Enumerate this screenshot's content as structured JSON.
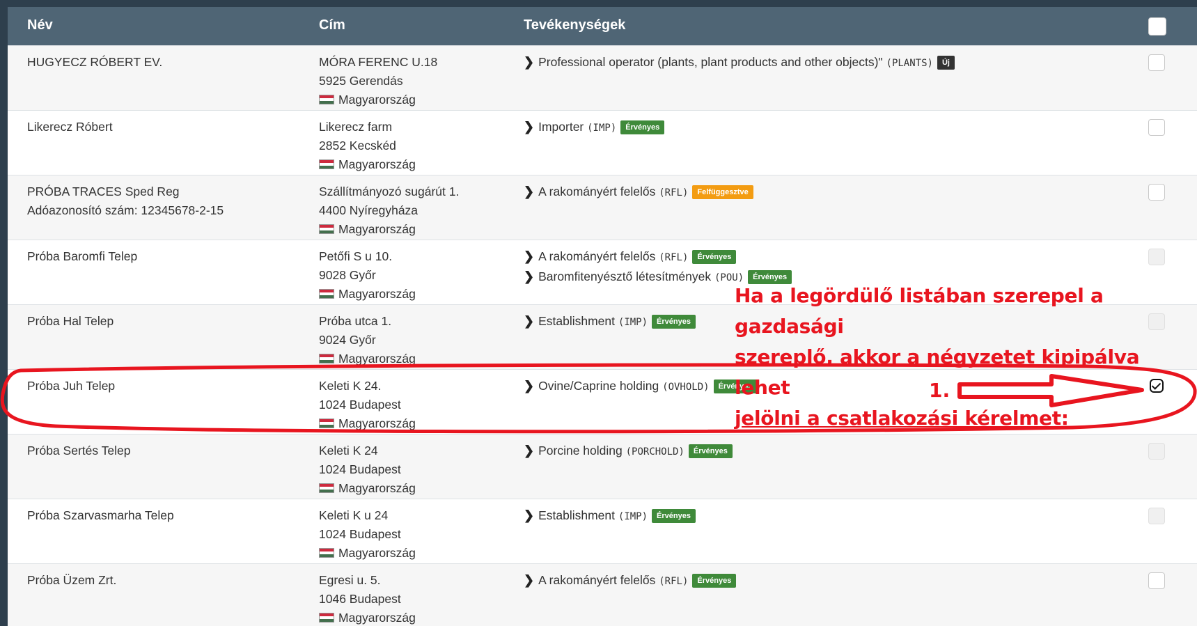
{
  "table": {
    "headers": {
      "name": "Név",
      "address": "Cím",
      "activities": "Tevékenységek"
    },
    "rows": [
      {
        "name": [
          "HUGYECZ RÓBERT EV."
        ],
        "address": [
          "MÓRA FERENC U.18",
          "5925 Gerendás",
          "Magyarország"
        ],
        "activities": [
          {
            "text": "Professional operator (plants, plant products and other objects)\"",
            "code": "(PLANTS)",
            "badge": "Új",
            "status": "dark"
          }
        ],
        "checkbox": "enabled"
      },
      {
        "name": [
          "Likerecz Róbert"
        ],
        "address": [
          "Likerecz farm",
          "2852 Kecskéd",
          "Magyarország"
        ],
        "activities": [
          {
            "text": "Importer",
            "code": "(IMP)",
            "badge": "Érvényes",
            "status": "green"
          }
        ],
        "checkbox": "enabled"
      },
      {
        "name": [
          "PRÓBA TRACES Sped Reg",
          "Adóazonosító szám: 12345678-2-15"
        ],
        "address": [
          "Szállítmányozó sugárút 1.",
          "4400 Nyíregyháza",
          "Magyarország"
        ],
        "activities": [
          {
            "text": "A rakományért felelős",
            "code": "(RFL)",
            "badge": "Felfüggesztve",
            "status": "orange"
          }
        ],
        "checkbox": "enabled"
      },
      {
        "name": [
          "Próba Baromfi Telep"
        ],
        "address": [
          "Petőfi S u 10.",
          "9028 Győr",
          "Magyarország"
        ],
        "activities": [
          {
            "text": "A rakományért felelős",
            "code": "(RFL)",
            "badge": "Érvényes",
            "status": "green"
          },
          {
            "text": "Baromfitenyésztő létesítmények",
            "code": "(POU)",
            "badge": "Érvényes",
            "status": "green"
          }
        ],
        "checkbox": "disabled"
      },
      {
        "name": [
          "Próba Hal Telep"
        ],
        "address": [
          "Próba utca 1.",
          "9024 Győr",
          "Magyarország"
        ],
        "activities": [
          {
            "text": "Establishment",
            "code": "(IMP)",
            "badge": "Érvényes",
            "status": "green"
          }
        ],
        "checkbox": "disabled"
      },
      {
        "name": [
          "Próba Juh Telep"
        ],
        "address": [
          "Keleti K 24.",
          "1024 Budapest",
          "Magyarország"
        ],
        "activities": [
          {
            "text": "Ovine/Caprine holding",
            "code": "(OVHOLD)",
            "badge": "Érvényes",
            "status": "green"
          }
        ],
        "checkbox": "checked"
      },
      {
        "name": [
          "Próba Sertés Telep"
        ],
        "address": [
          "Keleti K 24",
          "1024 Budapest",
          "Magyarország"
        ],
        "activities": [
          {
            "text": "Porcine holding",
            "code": "(PORCHOLD)",
            "badge": "Érvényes",
            "status": "green"
          }
        ],
        "checkbox": "disabled"
      },
      {
        "name": [
          "Próba Szarvasmarha Telep"
        ],
        "address": [
          "Keleti K u 24",
          "1024 Budapest",
          "Magyarország"
        ],
        "activities": [
          {
            "text": "Establishment",
            "code": "(IMP)",
            "badge": "Érvényes",
            "status": "green"
          }
        ],
        "checkbox": "disabled"
      },
      {
        "name": [
          "Próba Üzem Zrt."
        ],
        "address": [
          "Egresi u. 5.",
          "1046 Budapest",
          "Magyarország"
        ],
        "activities": [
          {
            "text": "A rakományért felelős",
            "code": "(RFL)",
            "badge": "Érvényes",
            "status": "green"
          }
        ],
        "checkbox": "enabled"
      }
    ]
  },
  "annotation": {
    "lines": [
      "Ha a legördülő listában szerepel a gazdasági",
      "szereplő, akkor a négyzetet kipipálva lehet",
      "jelölni a csatlakozási kérelmet:"
    ],
    "step": "1.",
    "color": "#e8151f"
  },
  "colors": {
    "header_bg": "#4f6575",
    "page_bg": "#2e3f4d",
    "badge_green": "#3f8a3a",
    "badge_orange": "#f39c12"
  }
}
